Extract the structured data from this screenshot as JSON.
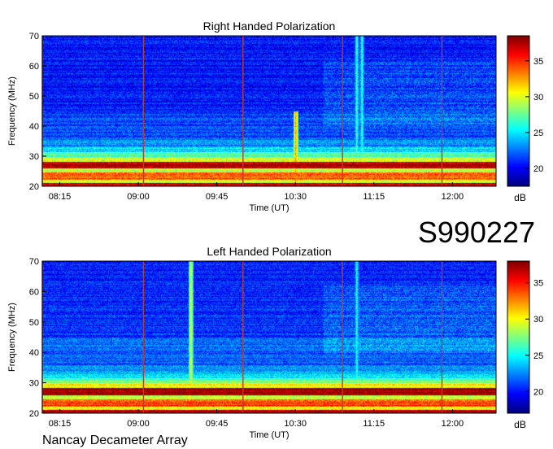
{
  "page": {
    "station_id": "S990227",
    "footer": "Nancay Decameter Array"
  },
  "chart_data": [
    {
      "type": "heatmap",
      "title": "Right Handed Polarization",
      "xlabel": "Time (UT)",
      "ylabel": "Frequency (MHz)",
      "x_ticks": [
        "08:15",
        "09:00",
        "09:45",
        "10:30",
        "11:15",
        "12:00"
      ],
      "y_ticks": [
        20,
        30,
        40,
        50,
        60,
        70
      ],
      "ylim": [
        20,
        70
      ],
      "xlim": [
        "08:05",
        "12:25"
      ],
      "colorbar": {
        "label": "dB",
        "ticks": [
          20,
          25,
          30,
          35
        ],
        "range": [
          17.5,
          38.5
        ]
      },
      "hour_markers": [
        "08:05",
        "09:03",
        "10:00",
        "10:57",
        "11:54"
      ],
      "bursts": [
        {
          "time": "10:30",
          "fmin": 20,
          "fmax": 45,
          "level_db": 33
        },
        {
          "time": "11:05",
          "fmin": 28,
          "fmax": 70,
          "level_db": 27
        },
        {
          "time": "11:08",
          "fmin": 28,
          "fmax": 70,
          "level_db": 27
        }
      ]
    },
    {
      "type": "heatmap",
      "title": "Left Handed Polarization",
      "xlabel": "Time (UT)",
      "ylabel": "Frequency (MHz)",
      "x_ticks": [
        "08:15",
        "09:00",
        "09:45",
        "10:30",
        "11:15",
        "12:00"
      ],
      "y_ticks": [
        20,
        30,
        40,
        50,
        60,
        70
      ],
      "ylim": [
        20,
        70
      ],
      "xlim": [
        "08:05",
        "12:25"
      ],
      "colorbar": {
        "label": "dB",
        "ticks": [
          20,
          25,
          30,
          35
        ],
        "range": [
          17.0,
          38.0
        ]
      },
      "hour_markers": [
        "08:05",
        "09:03",
        "10:00",
        "10:57",
        "11:54"
      ],
      "bursts": [
        {
          "time": "09:30",
          "fmin": 20,
          "fmax": 70,
          "level_db": 30
        },
        {
          "time": "11:05",
          "fmin": 28,
          "fmax": 70,
          "level_db": 26
        }
      ]
    }
  ]
}
